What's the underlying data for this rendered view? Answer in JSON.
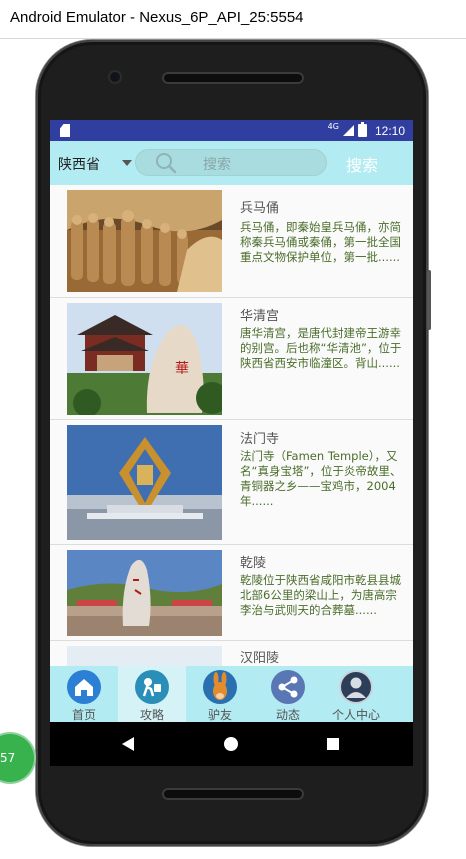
{
  "window": {
    "title": "Android Emulator - Nexus_6P_API_25:5554"
  },
  "status_bar": {
    "network": "4G",
    "time": "12:10"
  },
  "search_bar": {
    "province": "陕西省",
    "placeholder": "搜索",
    "search_button": "搜索"
  },
  "attractions": [
    {
      "title": "兵马俑",
      "desc": "兵马俑，即秦始皇兵马俑，亦简称秦兵马俑或秦俑，第一批全国重点文物保护单位，第一批......"
    },
    {
      "title": "华清宫",
      "desc": "唐华清宫，是唐代封建帝王游幸的别宫。后也称“华清池”，位于陕西省西安市临潼区。背山......"
    },
    {
      "title": "法门寺",
      "desc": "法门寺（Famen Temple），又名“真身宝塔”，位于炎帝故里、青铜器之乡——宝鸡市，2004年......"
    },
    {
      "title": "乾陵",
      "desc": "乾陵位于陕西省咸阳市乾县县城北部6公里的梁山上，为唐高宗李治与武则天的合葬墓......"
    },
    {
      "title": "汉阳陵",
      "desc": ""
    }
  ],
  "bottom_nav": [
    {
      "label": "首页",
      "icon": "home-icon",
      "selected": false
    },
    {
      "label": "攻略",
      "icon": "guide-icon",
      "selected": true
    },
    {
      "label": "驴友",
      "icon": "donkey-icon",
      "selected": false
    },
    {
      "label": "动态",
      "icon": "share-icon",
      "selected": false
    },
    {
      "label": "个人中心",
      "icon": "profile-icon",
      "selected": false
    }
  ],
  "floating_badge": {
    "text": "57"
  },
  "colors": {
    "accent": "#b2ebf2",
    "status_bar": "#303f9f",
    "desc_text": "#4a6d2a"
  }
}
